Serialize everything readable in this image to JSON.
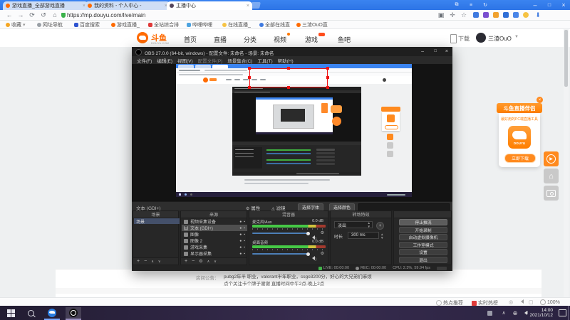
{
  "browser": {
    "tabs": [
      {
        "title": "游戏直播_全部游戏直播"
      },
      {
        "title": "我的资料 - 个人中心 -"
      },
      {
        "title": "主播中心"
      }
    ],
    "url": "https://mp.douyu.com/live/main",
    "bookmarks": [
      "收藏",
      "网址导航",
      "百度搜索",
      "游戏直播_",
      "全站综合排",
      "哔哩哔哩",
      "在线直播_",
      "全部在线直",
      "三渣OuO直"
    ],
    "statusbar": {
      "hot": "热点推荐",
      "trending": "实时热榜",
      "zoom": "100%"
    }
  },
  "douyu": {
    "logo_text": "斗鱼",
    "logo_sub": "DOUYU.COM",
    "nav": [
      "首页",
      "直播",
      "分类",
      "视频",
      "游戏",
      "鱼吧"
    ],
    "download": "下载",
    "username": "三渣OuO"
  },
  "obs": {
    "title": "OBS 27.0.0 (64-bit, windows) - 配置文件: 未命名 - 场景: 未命名",
    "menus": [
      "文件(F)",
      "编辑(E)",
      "视图(V)",
      "配置文件(P)",
      "场景集合(C)",
      "工具(T)",
      "帮助(H)"
    ],
    "context": {
      "source": "文本 (GDI+)",
      "properties": "属性",
      "filters": "滤镜",
      "font_button": "选择字体",
      "color_button": "选择颜色"
    },
    "scenes": {
      "header": "场景",
      "items": [
        "场景"
      ]
    },
    "sources": {
      "header": "来源",
      "items": [
        "视频采集设备",
        "文本 (GDI+)",
        "图像",
        "图像 2",
        "游戏采集",
        "显示器采集"
      ]
    },
    "mixer": {
      "header": "混音器",
      "channels": [
        {
          "name": "麦克风/Aux",
          "db": "0.0 dB"
        },
        {
          "name": "桌面音频",
          "db": "0.0 dB"
        }
      ]
    },
    "transitions": {
      "header": "转场特效",
      "type": "淡出",
      "duration_label": "时长",
      "duration": "300 ms"
    },
    "controls": {
      "header": "控件",
      "buttons": [
        "停止推流",
        "开始录制",
        "启动虚拟摄像机",
        "工作室模式",
        "设置",
        "退出"
      ]
    },
    "status": {
      "live": "LIVE: 00:00:00",
      "rec": "REC: 00:00:00",
      "perf": "CPU: 2.3%, 59.94 fps"
    }
  },
  "promo": {
    "title": "斗鱼直播伴侣",
    "subtitle": "最好用的PC端直播工具",
    "logo": "DOUYU",
    "download_button": "立即下载"
  },
  "announcement": {
    "label": "房间公告：",
    "line1": "pubg2年半 职业，valorant半年职业，csgo3200分，好心的大兄弟们麻烦",
    "line2": "点个关注卡个牌子谢谢 直播时间中午2点-晚上2点"
  },
  "taskbar": {
    "time": "14:00",
    "date": "2021/10/12"
  }
}
